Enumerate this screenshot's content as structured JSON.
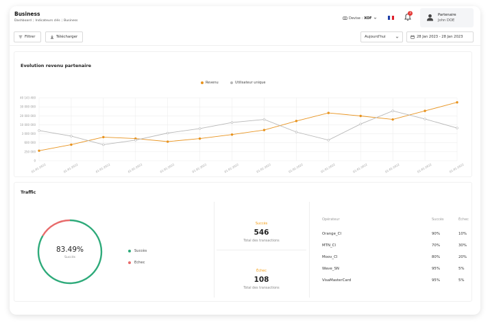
{
  "header": {
    "title": "Business",
    "breadcrumb": [
      "Dashboard",
      "Indicateurs clés",
      "Business"
    ],
    "devise_label": "Devise :",
    "devise_value": "XOF",
    "notifications_count": "3",
    "user_role": "Partenaire",
    "user_name": "John DOE",
    "flag_colors": [
      "#1f3fa8",
      "#ffffff",
      "#e0202c"
    ],
    "icons": [
      "currency-icon",
      "chevron-down-icon",
      "bell-icon",
      "user-icon"
    ]
  },
  "toolbar": {
    "filter_label": "Filtrer",
    "download_label": "Télécharger",
    "period_value": "Aujourd'hui",
    "date_range": "28 Jan 2023 - 28 Jan 2023",
    "icons": [
      "filter-icon",
      "download-icon",
      "chevron-down-icon",
      "calendar-icon"
    ]
  },
  "evolution": {
    "title": "Evolution revenu partenaire"
  },
  "colors": {
    "revenue": "#e8931e",
    "users": "#b7b7b7",
    "success": "#2eaa7a",
    "failure": "#e86b6b",
    "accent": "#f39c12"
  },
  "chart_data": [
    {
      "type": "line",
      "title": "Evolution revenu partenaire",
      "categories": [
        "01-01-2022",
        "01-01-2022",
        "01-01-2022",
        "01-01-2022",
        "01-01-2022",
        "01-01-2022",
        "01-01-2022",
        "01-01-2022",
        "01-01-2022",
        "01-01-2022",
        "01-01-2022",
        "01-01-2022",
        "01-01-2022",
        "01-01-2022"
      ],
      "yticks": [
        "40 143 400",
        "30 000 000",
        "20 000 000",
        "10 000 000",
        "3 000 000",
        "600 000",
        "250 000",
        "0"
      ],
      "series": [
        {
          "name": "Revenu",
          "values": [
            1,
            1.6,
            2.35,
            2.2,
            1.9,
            2.2,
            2.6,
            3.05,
            3.95,
            4.75,
            4.45,
            4.1,
            4.95,
            5.8
          ]
        },
        {
          "name": "Utilisateur unique",
          "values": [
            3.0,
            2.45,
            1.6,
            2.05,
            2.75,
            3.2,
            3.8,
            4.1,
            2.85,
            2.05,
            3.65,
            4.95,
            4.15,
            3.25
          ]
        }
      ],
      "ylim": [
        0,
        6.25
      ],
      "grid": true,
      "legend": "top-center"
    },
    {
      "type": "pie",
      "labels": [
        "Succès",
        "Echec"
      ],
      "values": [
        83.49,
        16.51
      ]
    }
  ],
  "traffic": {
    "title": "Traffic",
    "donut_percent": "83.49%",
    "donut_label": "Succès",
    "legend_success": "Succès",
    "legend_failure": "Echec",
    "success_label": "Succès",
    "success_count": "546",
    "success_sub": "Total des transactions",
    "failure_label": "Échec",
    "failure_count": "108",
    "failure_sub": "Total des transactions",
    "table": {
      "headers": [
        "Opérateur",
        "Succès",
        "Échec"
      ],
      "rows": [
        [
          "Orange_CI",
          "90%",
          "10%"
        ],
        [
          "MTN_CI",
          "70%",
          "30%"
        ],
        [
          "Moov_CI",
          "80%",
          "20%"
        ],
        [
          "Wave_SN",
          "95%",
          "5%"
        ],
        [
          "VisaMasterCard",
          "95%",
          "5%"
        ]
      ]
    }
  }
}
